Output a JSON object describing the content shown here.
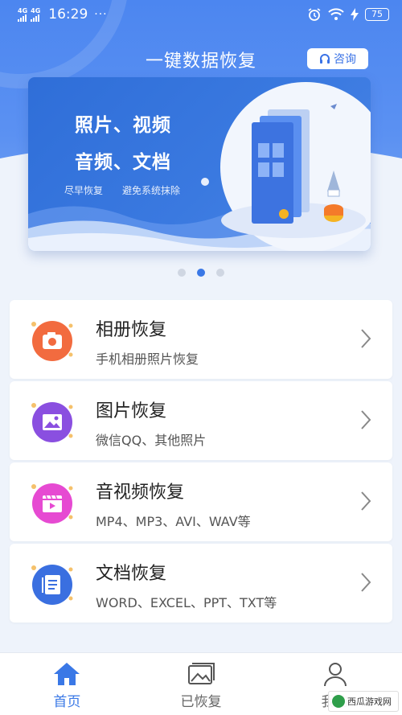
{
  "status_bar": {
    "network_1": "4G",
    "network_2": "4G",
    "time": "16:29",
    "more": "···",
    "battery": "75"
  },
  "header": {
    "title": "一键数据恢复",
    "consult_label": "咨询"
  },
  "banner": {
    "line1": "照片、视频",
    "line2": "音频、文档",
    "sub1": "尽早恢复",
    "sub2": "避免系统抹除"
  },
  "carousel": {
    "count": 3,
    "active": 1
  },
  "features": [
    {
      "title": "相册恢复",
      "subtitle": "手机相册照片恢复",
      "icon": "camera-icon",
      "color": "#f26b3f"
    },
    {
      "title": "图片恢复",
      "subtitle": "微信QQ、其他照片",
      "icon": "picture-icon",
      "color": "#8a4fe0"
    },
    {
      "title": "音视频恢复",
      "subtitle": "MP4、MP3、AVI、WAV等",
      "icon": "video-icon",
      "color": "#e64ad2"
    },
    {
      "title": "文档恢复",
      "subtitle": "WORD、EXCEL、PPT、TXT等",
      "icon": "document-icon",
      "color": "#3a6fe0"
    }
  ],
  "bottom_nav": [
    {
      "label": "首页",
      "icon": "home-icon",
      "active": true
    },
    {
      "label": "已恢复",
      "icon": "gallery-icon",
      "active": false
    },
    {
      "label": "我的",
      "icon": "user-icon",
      "active": false
    }
  ],
  "watermark": "西瓜游戏网",
  "colors": {
    "primary": "#3a78e6",
    "background": "#eef3fb"
  }
}
